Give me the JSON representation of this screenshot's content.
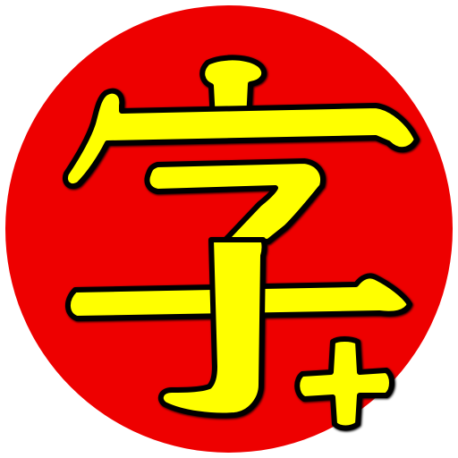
{
  "icon": {
    "glyph": "字",
    "badge_symbol": "+",
    "background_color": "#ffffff",
    "circle_color": "#ee0000",
    "glyph_fill_color": "#ffff00",
    "glyph_stroke_color": "#000000"
  }
}
